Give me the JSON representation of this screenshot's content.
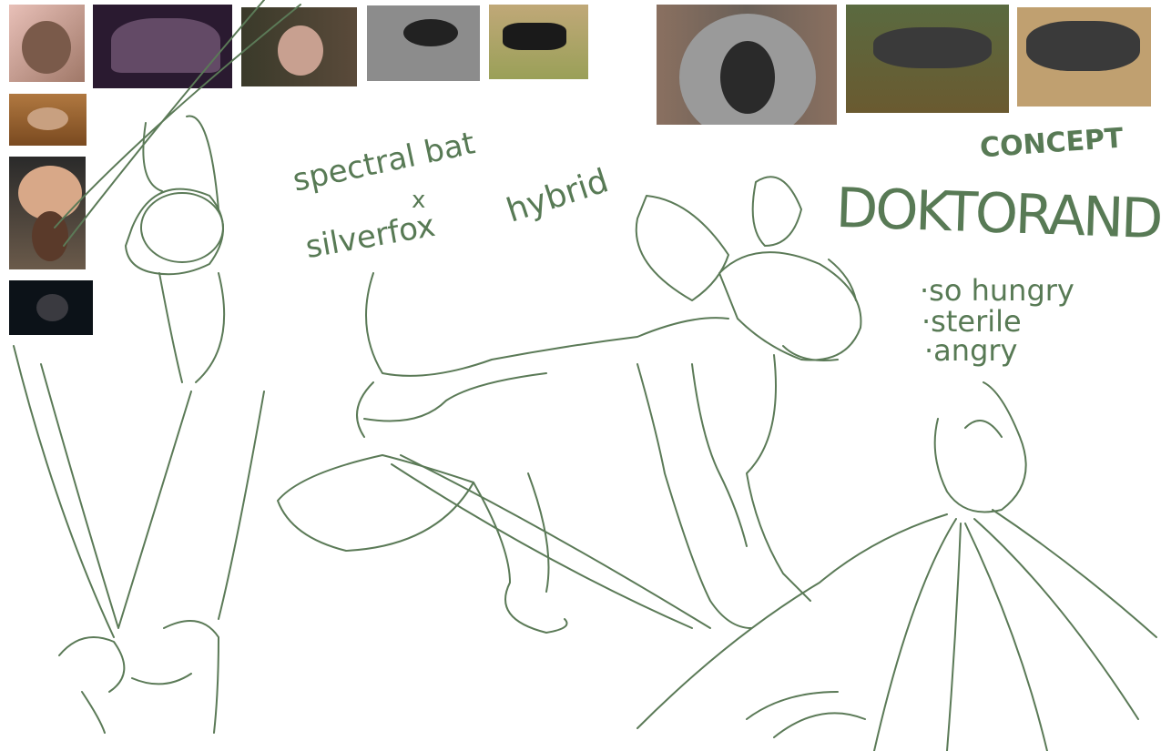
{
  "title_label": "CONCEPT",
  "character_name": "DOKTORAND",
  "hybrid_note": {
    "line1": "spectral bat",
    "cross": "x",
    "line2": "silverfox",
    "line3": "hybrid"
  },
  "traits": [
    "·so hungry",
    "·sterile",
    "·angry"
  ],
  "colors": {
    "ink": "#5b7a57",
    "background": "#ffffff"
  },
  "reference_photos": [
    {
      "subject": "bat-face",
      "color": "#b08878"
    },
    {
      "subject": "bat-flying",
      "color": "#2a1a30"
    },
    {
      "subject": "bat-closeup",
      "color": "#3a3a2a"
    },
    {
      "subject": "fox-lying",
      "color": "#8a8a8a"
    },
    {
      "subject": "fox-field",
      "color": "#a89a60"
    },
    {
      "subject": "fox-face",
      "color": "#6a6058"
    },
    {
      "subject": "fox-walking",
      "color": "#5a6040"
    },
    {
      "subject": "fox-standing",
      "color": "#b09870"
    },
    {
      "subject": "bat-cave",
      "color": "#a07040"
    },
    {
      "subject": "bat-ears",
      "color": "#8a6a50"
    },
    {
      "subject": "bat-night",
      "color": "#101820"
    }
  ]
}
